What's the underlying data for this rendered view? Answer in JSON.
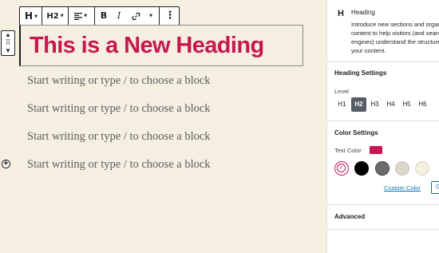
{
  "toolbar": {
    "block_type": "H",
    "heading_level": "H2",
    "align_icon": "align-left-icon",
    "bold": "B",
    "italic": "I",
    "link_icon": "link-icon",
    "more_icon": "more-vertical-icon"
  },
  "mover": {
    "up": "▴",
    "drag": "⠿",
    "down": "▾"
  },
  "editor": {
    "heading": "This is a New Heading",
    "placeholders": [
      "Start writing or type / to choose a block",
      "Start writing or type / to choose a block",
      "Start writing or type / to choose a block",
      "Start writing or type / to choose a block"
    ],
    "add_block": "+"
  },
  "sidebar": {
    "block_card": {
      "icon": "H",
      "title": "Heading",
      "description": "Introduce new sections and organize content to help visitors (and search engines) understand the structure of your content."
    },
    "heading_settings": {
      "title": "Heading Settings",
      "level_label": "Level",
      "levels": [
        "H1",
        "H2",
        "H3",
        "H4",
        "H5",
        "H6"
      ],
      "active_level": "H2"
    },
    "color_settings": {
      "title": "Color Settings",
      "text_color_label": "Text Color",
      "text_color": "#c8174f",
      "swatches": [
        "#ffffff",
        "#000000",
        "#6b6b6b",
        "#dcd7ca",
        "#f5efe0"
      ],
      "custom_color_link": "Custom Color",
      "clear_button": "C"
    },
    "advanced": {
      "title": "Advanced"
    }
  },
  "colors": {
    "accent": "#c8174f",
    "canvas_bg": "#f5efe1",
    "link": "#0073aa"
  }
}
